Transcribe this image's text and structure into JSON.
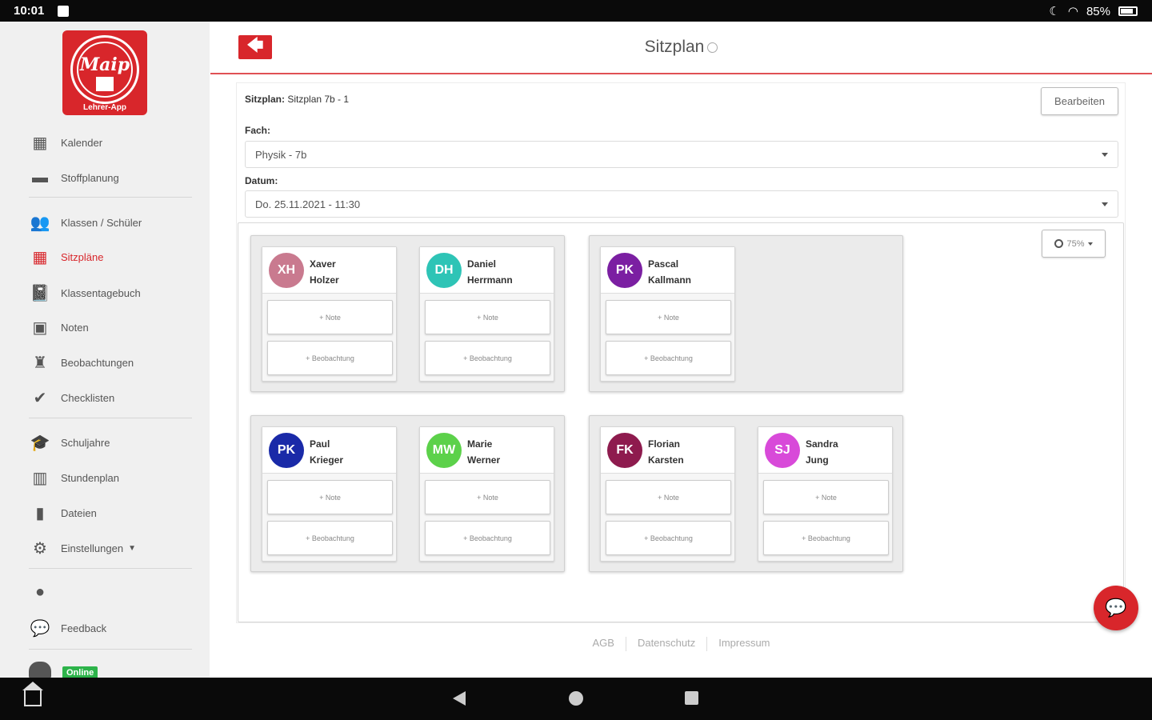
{
  "statusbar": {
    "time": "10:01",
    "battery": "85%"
  },
  "logo": {
    "mark": "Maip",
    "subtitle": "Lehrer-App"
  },
  "sidebar": {
    "items": [
      {
        "label": "Kalender",
        "icon": "calendar-icon",
        "glyph": "▦"
      },
      {
        "label": "Stoffplanung",
        "icon": "archive-icon",
        "glyph": "▬"
      },
      {
        "label": "Klassen / Schüler",
        "icon": "users-icon",
        "glyph": "👥"
      },
      {
        "label": "Sitzpläne",
        "icon": "grid-icon",
        "glyph": "▦",
        "active": true
      },
      {
        "label": "Klassentagebuch",
        "icon": "book-icon",
        "glyph": "📓"
      },
      {
        "label": "Noten",
        "icon": "contact-book-icon",
        "glyph": "▣"
      },
      {
        "label": "Beobachtungen",
        "icon": "binoculars-icon",
        "glyph": "♜"
      },
      {
        "label": "Checklisten",
        "icon": "check-circle-icon",
        "glyph": "✔"
      },
      {
        "label": "Schuljahre",
        "icon": "graduation-cap-icon",
        "glyph": "🎓"
      },
      {
        "label": "Stundenplan",
        "icon": "columns-icon",
        "glyph": "▥"
      },
      {
        "label": "Dateien",
        "icon": "file-icon",
        "glyph": "▮"
      },
      {
        "label": "Einstellungen",
        "icon": "gear-icon",
        "glyph": "⚙"
      },
      {
        "label": "",
        "icon": "user-icon",
        "glyph": "●"
      },
      {
        "label": "Feedback",
        "icon": "comment-icon",
        "glyph": "💬"
      }
    ],
    "online": "Online"
  },
  "header": {
    "title": "Sitzplan",
    "back_glyph": "🡄"
  },
  "form": {
    "plan_label": "Sitzplan:",
    "plan_value": "Sitzplan 7b - 1",
    "edit_button": "Bearbeiten",
    "subject_label": "Fach:",
    "subject_value": "Physik - 7b",
    "date_label": "Datum:",
    "date_value": "Do. 25.11.2021 - 11:30"
  },
  "zoom": {
    "value": "75%"
  },
  "seat_buttons": {
    "note": "+ Note",
    "observation": "+ Beobachtung"
  },
  "students": [
    {
      "initials": "XH",
      "first": "Xaver",
      "last": "Holzer",
      "color": "#c97a8f"
    },
    {
      "initials": "DH",
      "first": "Daniel",
      "last": "Herrmann",
      "color": "#2ec4b6"
    },
    {
      "initials": "PK",
      "first": "Pascal",
      "last": "Kallmann",
      "color": "#7b1fa2"
    },
    {
      "initials": "PK",
      "first": "Paul",
      "last": "Krieger",
      "color": "#1a2aa8"
    },
    {
      "initials": "MW",
      "first": "Marie",
      "last": "Werner",
      "color": "#5cd14a"
    },
    {
      "initials": "FK",
      "first": "Florian",
      "last": "Karsten",
      "color": "#8e1b4e"
    },
    {
      "initials": "SJ",
      "first": "Sandra",
      "last": "Jung",
      "color": "#d84ad9"
    }
  ],
  "footer": {
    "links": [
      "AGB",
      "Datenschutz",
      "Impressum"
    ]
  },
  "colors": {
    "accent": "#d8262b",
    "online": "#2db34a"
  }
}
